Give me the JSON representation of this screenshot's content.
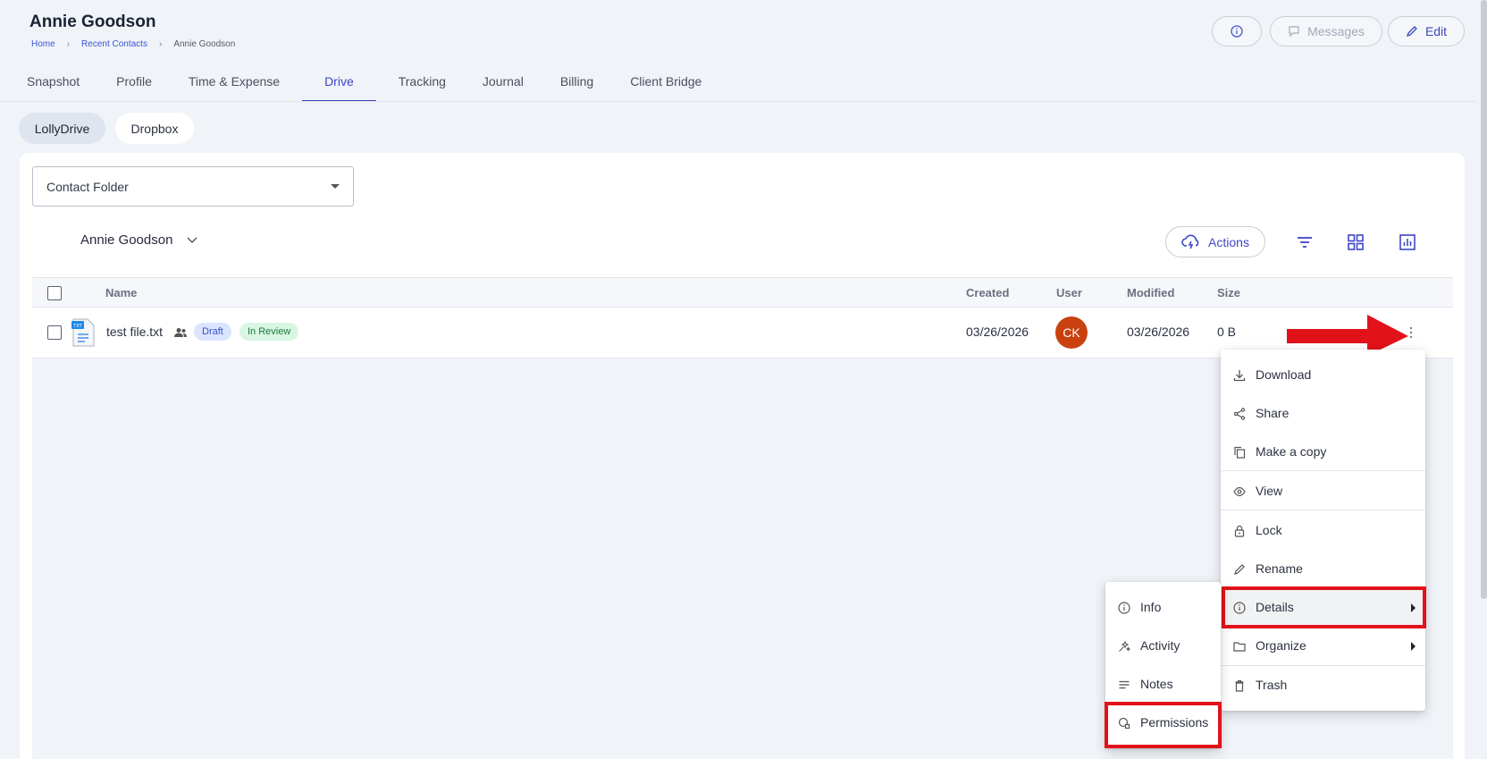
{
  "header": {
    "title": "Annie Goodson",
    "breadcrumb": [
      "Home",
      "Recent Contacts",
      "Annie Goodson"
    ],
    "messages_label": "Messages",
    "edit_label": "Edit"
  },
  "tabs": [
    "Snapshot",
    "Profile",
    "Time & Expense",
    "Drive",
    "Tracking",
    "Journal",
    "Billing",
    "Client Bridge"
  ],
  "active_tab": "Drive",
  "storage_tabs": [
    "LollyDrive",
    "Dropbox"
  ],
  "folder_select": {
    "value": "Contact Folder"
  },
  "owner": "Annie Goodson",
  "toolbar": {
    "actions_label": "Actions"
  },
  "table": {
    "columns": [
      "Name",
      "Created",
      "User",
      "Modified",
      "Size"
    ],
    "rows": [
      {
        "name": "test file.txt",
        "badges": [
          "Draft",
          "In Review"
        ],
        "created": "03/26/2026",
        "user_initials": "CK",
        "modified": "03/26/2026",
        "size": "0 B",
        "file_icon_label": "TXT"
      }
    ]
  },
  "context_menu": {
    "items": [
      "Download",
      "Share",
      "Make a copy",
      "View",
      "Lock",
      "Rename",
      "Details",
      "Organize",
      "Trash"
    ],
    "highlighted": "Details"
  },
  "details_submenu": {
    "items": [
      "Info",
      "Activity",
      "Notes",
      "Permissions"
    ],
    "highlighted": "Permissions"
  },
  "colors": {
    "accent": "#3c46c6",
    "annotation_red": "#e2121a",
    "avatar": "#c8410f"
  }
}
